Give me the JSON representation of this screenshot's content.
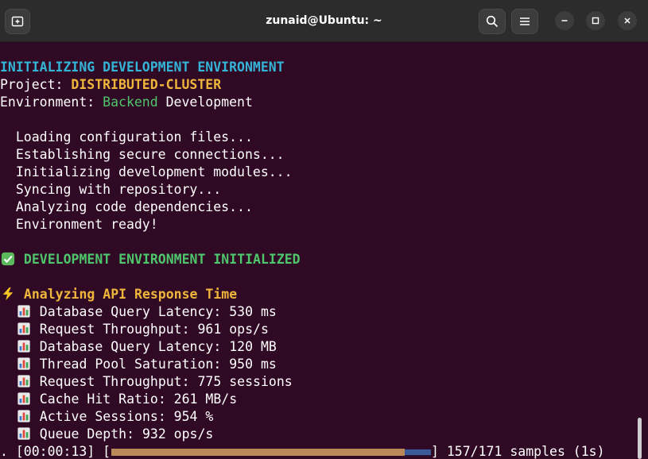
{
  "window": {
    "title": "zunaid@Ubuntu: ~"
  },
  "terminal": {
    "header": "INITIALIZING DEVELOPMENT ENVIRONMENT",
    "project_label": "Project: ",
    "project_value": "DISTRIBUTED-CLUSTER",
    "env_label": "Environment: ",
    "env_value": "Backend",
    "env_suffix": " Development",
    "steps": [
      "  Loading configuration files...",
      "  Establishing secure connections...",
      "  Initializing development modules...",
      "  Syncing with repository...",
      "  Analyzing code dependencies...",
      "  Environment ready!"
    ],
    "initialized": " DEVELOPMENT ENVIRONMENT INITIALIZED",
    "analyzing": " Analyzing API Response Time",
    "metrics": [
      " Database Query Latency: 530 ms",
      " Request Throughput: 961 ops/s",
      " Database Query Latency: 120 MB",
      " Thread Pool Saturation: 950 ms",
      " Request Throughput: 775 sessions",
      " Cache Hit Ratio: 261 MB/s",
      " Active Sessions: 954 %",
      " Queue Depth: 932 ops/s"
    ],
    "progress": {
      "prefix": ". [00:00:13] [",
      "suffix": "] 157/171 samples (1s)",
      "done": 157,
      "total": 171
    }
  },
  "colors": {
    "cyan": "#34b5d8",
    "yellow": "#f0b63c",
    "green": "#4ec66c",
    "background": "#300a24"
  },
  "icons": [
    "new-tab-icon",
    "search-icon",
    "hamburger-menu-icon",
    "minimize-icon",
    "maximize-icon",
    "close-icon",
    "check-mark-icon",
    "lightning-icon",
    "bar-chart-icon"
  ]
}
